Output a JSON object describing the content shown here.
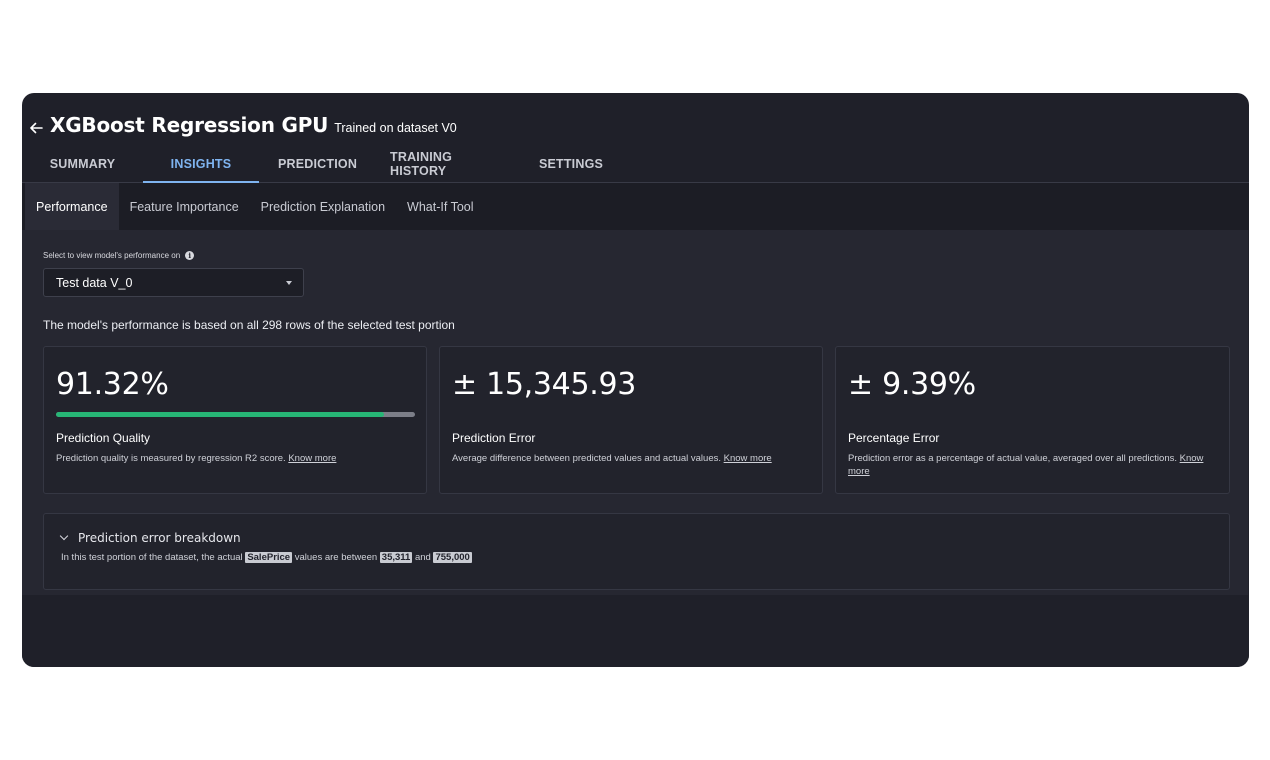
{
  "header": {
    "model_name": "XGBoost Regression GPU",
    "dataset_label": "Trained on dataset V0"
  },
  "tabs": [
    {
      "label": "SUMMARY"
    },
    {
      "label": "INSIGHTS",
      "active": true
    },
    {
      "label": "PREDICTION"
    },
    {
      "label": "TRAINING HISTORY"
    },
    {
      "label": "SETTINGS"
    }
  ],
  "subtabs": [
    {
      "label": "Performance",
      "active": true
    },
    {
      "label": "Feature Importance"
    },
    {
      "label": "Prediction Explanation"
    },
    {
      "label": "What-If Tool"
    }
  ],
  "performance": {
    "select_label": "Select to view model's performance on",
    "selected_dataset": "Test data V_0",
    "note": "The model's performance is based on all 298 rows of the selected test portion"
  },
  "cards": [
    {
      "value": "91.32%",
      "progress": 0.9132,
      "name": "Prediction Quality",
      "desc": "Prediction quality is measured by regression R2 score.",
      "link": "Know more"
    },
    {
      "value": "± 15,345.93",
      "name": "Prediction Error",
      "desc": "Average difference between predicted values and actual values.",
      "link": "Know more"
    },
    {
      "value": "± 9.39%",
      "name": "Percentage Error",
      "desc": "Prediction error as a percentage of actual value, averaged over all predictions.",
      "link": "Know more"
    }
  ],
  "breakdown": {
    "title": "Prediction error breakdown",
    "text_prefix": "In this test portion of the dataset, the actual",
    "target": "SalePrice",
    "text_mid": "values are between",
    "min": "35,311",
    "and": "and",
    "max": "755,000"
  },
  "colors": {
    "accent": "#7fb4f0",
    "progress": "#27b676",
    "background": "#1f2029"
  }
}
